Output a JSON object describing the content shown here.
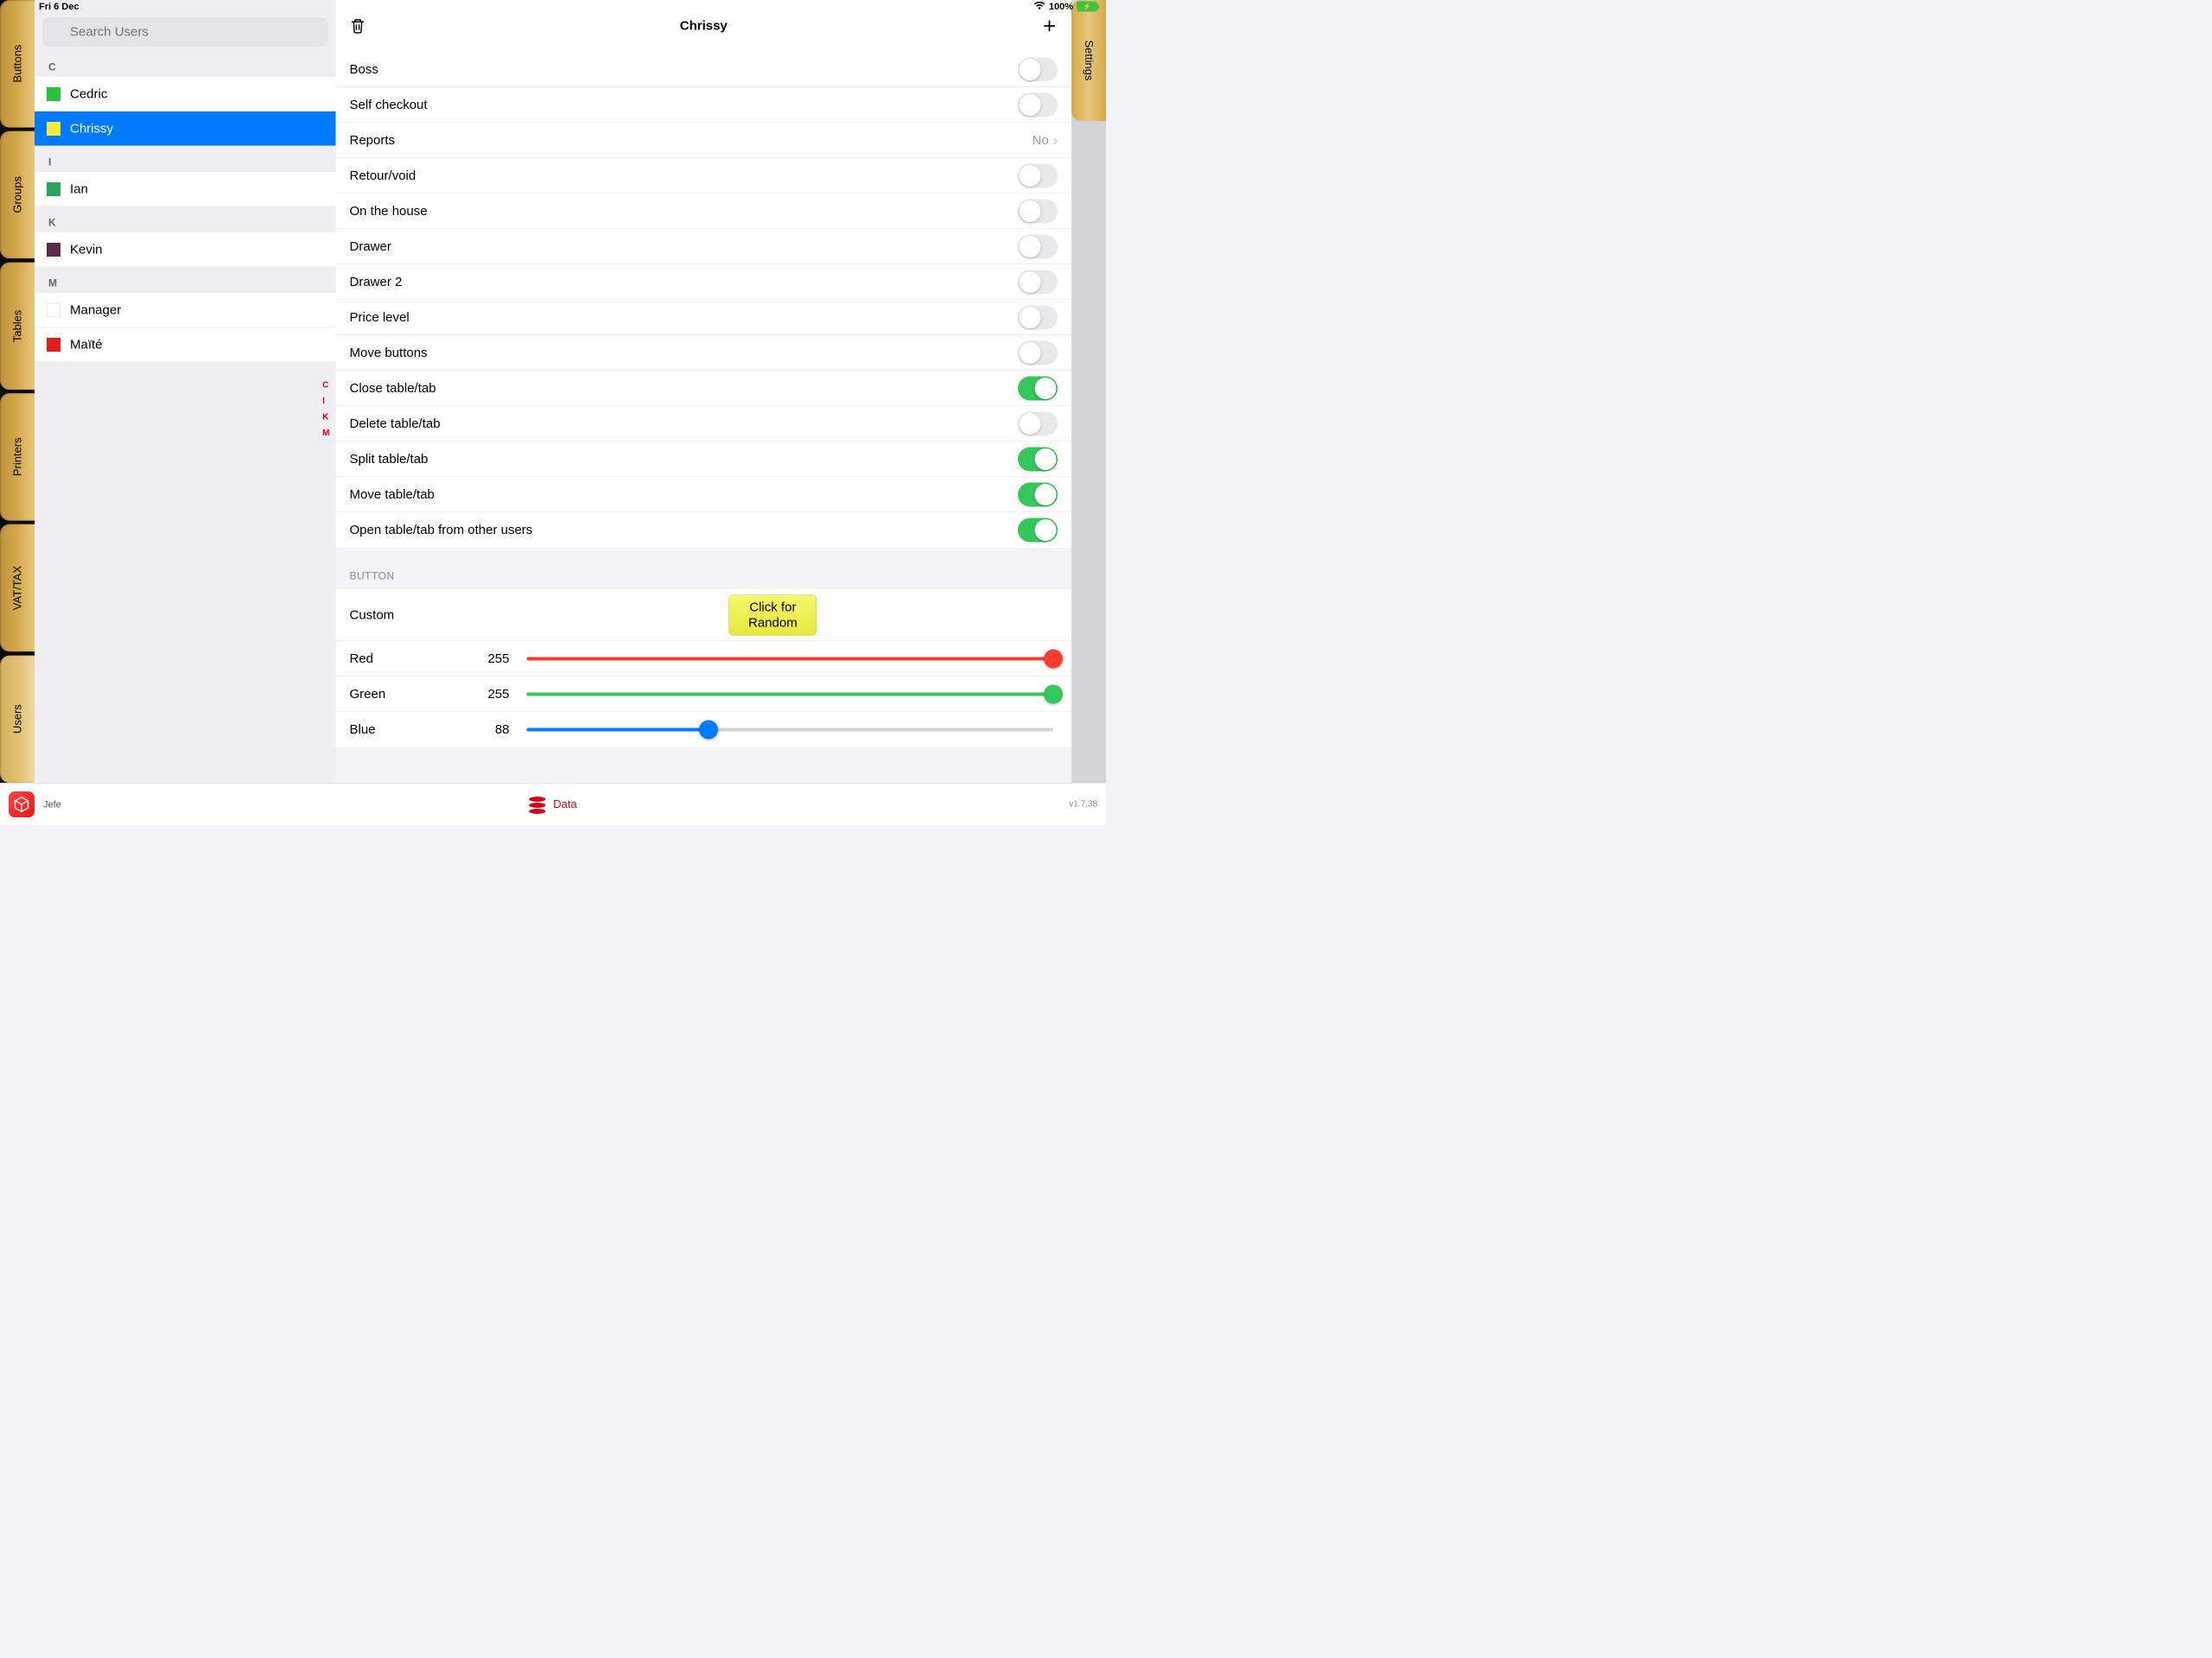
{
  "status": {
    "date": "Fri 6 Dec",
    "battery": "100%"
  },
  "tabs": {
    "left": [
      "Buttons",
      "Groups",
      "Tables",
      "Printers",
      "VAT/TAX",
      "Users"
    ],
    "selected_left": "Users",
    "right": [
      "Settings"
    ]
  },
  "search": {
    "placeholder": "Search Users"
  },
  "index_letters": [
    "C",
    "I",
    "K",
    "M"
  ],
  "user_sections": [
    {
      "letter": "C",
      "users": [
        {
          "name": "Cedric",
          "color": "#29c23a"
        },
        {
          "name": "Chrissy",
          "color": "#f7e93b",
          "selected": true
        }
      ]
    },
    {
      "letter": "I",
      "users": [
        {
          "name": "Ian",
          "color": "#2ca35a"
        }
      ]
    },
    {
      "letter": "K",
      "users": [
        {
          "name": "Kevin",
          "color": "#5a2a4a"
        }
      ]
    },
    {
      "letter": "M",
      "users": [
        {
          "name": "Manager",
          "color": "#ffffff"
        },
        {
          "name": "Maïté",
          "color": "#e21b1b"
        }
      ]
    }
  ],
  "detail": {
    "title": "Chrissy",
    "permissions": [
      {
        "label": "Boss",
        "type": "toggle",
        "on": false
      },
      {
        "label": "Self checkout",
        "type": "toggle",
        "on": false
      },
      {
        "label": "Reports",
        "type": "nav",
        "value": "No"
      },
      {
        "label": "Retour/void",
        "type": "toggle",
        "on": false
      },
      {
        "label": "On the house",
        "type": "toggle",
        "on": false
      },
      {
        "label": "Drawer",
        "type": "toggle",
        "on": false
      },
      {
        "label": "Drawer 2",
        "type": "toggle",
        "on": false
      },
      {
        "label": "Price level",
        "type": "toggle",
        "on": false
      },
      {
        "label": "Move buttons",
        "type": "toggle",
        "on": false
      },
      {
        "label": "Close table/tab",
        "type": "toggle",
        "on": true
      },
      {
        "label": "Delete table/tab",
        "type": "toggle",
        "on": false
      },
      {
        "label": "Split table/tab",
        "type": "toggle",
        "on": true
      },
      {
        "label": "Move table/tab",
        "type": "toggle",
        "on": true
      },
      {
        "label": "Open table/tab from other users",
        "type": "toggle",
        "on": true
      }
    ],
    "button_section_label": "BUTTON",
    "custom_label": "Custom",
    "random_label_l1": "Click for",
    "random_label_l2": "Random",
    "sliders": [
      {
        "label": "Red",
        "value": 255,
        "max": 255,
        "fill": "#ff3b30",
        "thumb": "#ff3b30"
      },
      {
        "label": "Green",
        "value": 255,
        "max": 255,
        "fill": "#34c759",
        "thumb": "#34c759"
      },
      {
        "label": "Blue",
        "value": 88,
        "max": 255,
        "fill": "#007aff",
        "thumb": "#007aff"
      }
    ]
  },
  "footer": {
    "app": "Jefe",
    "data_label": "Data",
    "version": "v1.7.38"
  }
}
